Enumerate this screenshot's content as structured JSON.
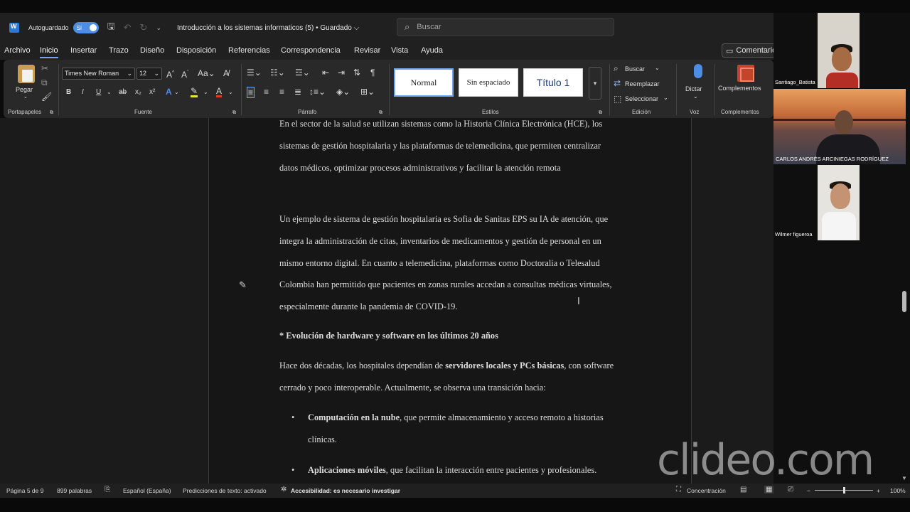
{
  "titlebar": {
    "autosave_label": "Autoguardado",
    "autosave_toggle": "Sí",
    "document_title": "Introducción a los sistemas informaticos (5) • Guardado ⌵",
    "search_placeholder": "Buscar"
  },
  "menu": {
    "tabs": [
      "Archivo",
      "Inicio",
      "Insertar",
      "Trazo",
      "Diseño",
      "Disposición",
      "Referencias",
      "Correspondencia",
      "Revisar",
      "Vista",
      "Ayuda"
    ],
    "active_tab": "Inicio",
    "comments_label": "Comentario"
  },
  "ribbon": {
    "clipboard": {
      "paste_label": "Pegar",
      "group_label": "Portapapeles"
    },
    "font": {
      "family": "Times New Roman",
      "size": "12",
      "group_label": "Fuente"
    },
    "paragraph": {
      "group_label": "Párrafo"
    },
    "styles": {
      "items": [
        "Normal",
        "Sin espaciado",
        "Título 1"
      ],
      "selected": "Normal",
      "group_label": "Estilos"
    },
    "editing": {
      "find": "Buscar",
      "replace": "Reemplazar",
      "select": "Seleccionar",
      "group_label": "Edición"
    },
    "voice": {
      "dictate": "Dictar",
      "group_label": "Voz"
    },
    "addins": {
      "label": "Complementos",
      "group_label": "Complementos"
    }
  },
  "document": {
    "para1": "En el sector de la salud se utilizan sistemas como la Historia Clínica Electrónica (HCE), los sistemas de gestión hospitalaria y las plataformas de telemedicina, que permiten centralizar datos médicos, optimizar procesos administrativos y facilitar la atención remota",
    "para2": "Un ejemplo de sistema de gestión hospitalaria es Sofia de Sanitas EPS su IA de atención, que integra la administración de citas, inventarios de medicamentos y gestión de personal en un mismo entorno digital. En cuanto a telemedicina, plataformas como Doctoralia o Telesalud Colombia han permitido que pacientes en zonas rurales accedan a consultas médicas virtuales, especialmente durante la pandemia de COVID-19.",
    "heading": "* Evolución de hardware y software en los últimos 20 años",
    "para3_pre": "Hace dos décadas, los hospitales dependían de ",
    "para3_bold": "servidores locales y PCs básicas",
    "para3_post": ", con software cerrado y poco interoperable. Actualmente, se observa una transición hacia:",
    "bullets": [
      {
        "bold": "Computación en la nube",
        "text": ", que permite almacenamiento y acceso remoto a historias clínicas."
      },
      {
        "bold": "Aplicaciones móviles",
        "text": ", que facilitan la interacción entre pacientes y profesionales."
      }
    ]
  },
  "participants": [
    {
      "name": "Santiago_Batista"
    },
    {
      "name": "CARLOS ANDRÉS ARCINIEGAS RODRÍGUEZ"
    },
    {
      "name": "Wilmer figueroa"
    }
  ],
  "statusbar": {
    "page": "Página 5 de 9",
    "words": "899 palabras",
    "language": "Español (España)",
    "predictions": "Predicciones de texto: activado",
    "accessibility": "Accesibilidad: es necesario investigar",
    "focus": "Concentración",
    "zoom": "100%"
  },
  "watermark": "clideo.com"
}
